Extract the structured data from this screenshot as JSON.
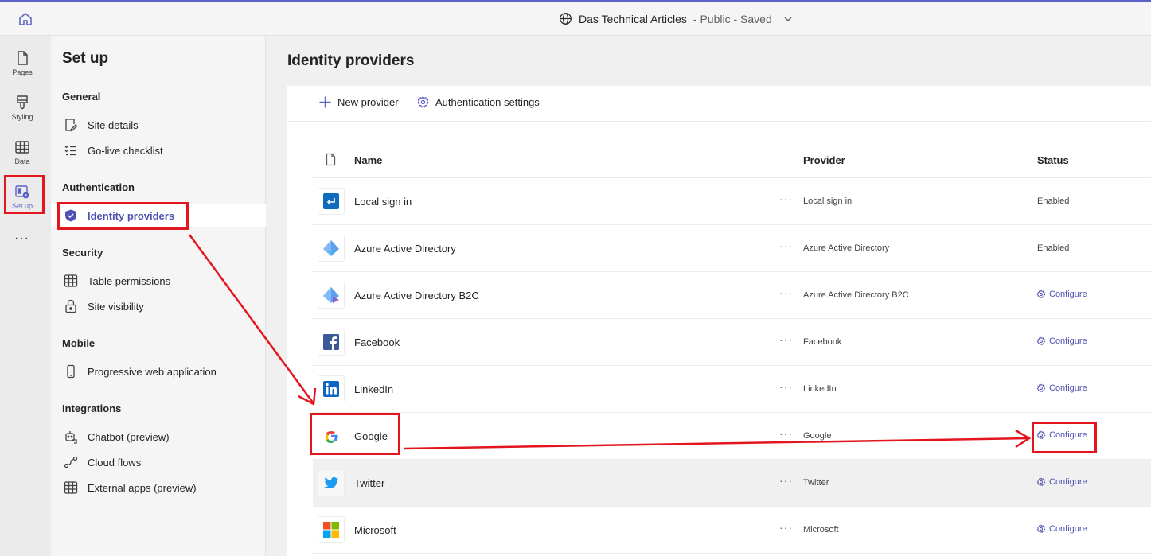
{
  "topbar": {
    "site_name": "Das Technical Articles",
    "site_status": " - Public - Saved"
  },
  "rail": {
    "items": [
      {
        "label": "Pages",
        "icon": "page-icon"
      },
      {
        "label": "Styling",
        "icon": "paintbrush-icon"
      },
      {
        "label": "Data",
        "icon": "table-icon"
      },
      {
        "label": "Set up",
        "icon": "setup-icon"
      }
    ],
    "more": "···"
  },
  "nav": {
    "title": "Set up",
    "sections": {
      "general": "General",
      "authentication": "Authentication",
      "security": "Security",
      "mobile": "Mobile",
      "integrations": "Integrations"
    },
    "items": {
      "site_details": "Site details",
      "golive_checklist": "Go-live checklist",
      "identity_providers": "Identity providers",
      "table_permissions": "Table permissions",
      "site_visibility": "Site visibility",
      "pwa": "Progressive web application",
      "chatbot": "Chatbot (preview)",
      "cloud_flows": "Cloud flows",
      "external_apps": "External apps (preview)"
    }
  },
  "main": {
    "heading": "Identity providers",
    "commands": {
      "new_provider": "New provider",
      "auth_settings": "Authentication settings"
    },
    "table": {
      "headers": {
        "name": "Name",
        "provider": "Provider",
        "status": "Status"
      },
      "more": "···",
      "rows": [
        {
          "name": "Local sign in",
          "provider": "Local sign in",
          "status": "Enabled",
          "logo": "local-signin-icon"
        },
        {
          "name": "Azure Active Directory",
          "provider": "Azure Active Directory",
          "status": "Enabled",
          "logo": "azure-ad-icon"
        },
        {
          "name": "Azure Active Directory B2C",
          "provider": "Azure Active Directory B2C",
          "status": "Configure",
          "logo": "azure-ad-b2c-icon"
        },
        {
          "name": "Facebook",
          "provider": "Facebook",
          "status": "Configure",
          "logo": "facebook-icon"
        },
        {
          "name": "LinkedIn",
          "provider": "LinkedIn",
          "status": "Configure",
          "logo": "linkedin-icon"
        },
        {
          "name": "Google",
          "provider": "Google",
          "status": "Configure",
          "logo": "google-icon"
        },
        {
          "name": "Twitter",
          "provider": "Twitter",
          "status": "Configure",
          "logo": "twitter-icon"
        },
        {
          "name": "Microsoft",
          "provider": "Microsoft",
          "status": "Configure",
          "logo": "microsoft-icon"
        }
      ]
    }
  },
  "colors": {
    "accent": "#5b5fc7",
    "annotation_red": "#e3151e"
  }
}
